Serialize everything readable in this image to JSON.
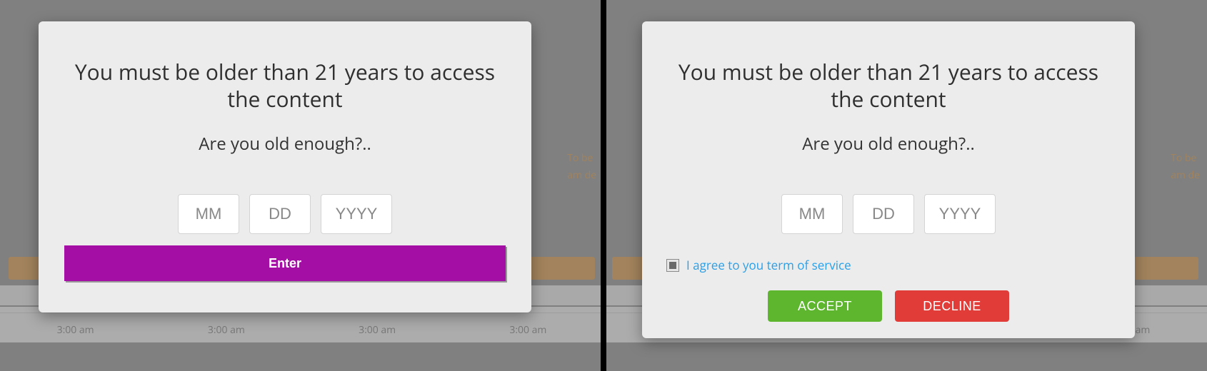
{
  "left": {
    "title": "You must be older than 21 years to access the content",
    "subtitle": "Are you old enough?..",
    "inputs": {
      "mm_placeholder": "MM",
      "dd_placeholder": "DD",
      "yyyy_placeholder": "YYYY",
      "mm_value": "",
      "dd_value": "",
      "yyyy_value": ""
    },
    "enter_label": "Enter"
  },
  "right": {
    "title": "You must be older than 21 years to access the content",
    "subtitle": "Are you old enough?..",
    "inputs": {
      "mm_placeholder": "MM",
      "dd_placeholder": "DD",
      "yyyy_placeholder": "YYYY",
      "mm_value": "",
      "dd_value": "",
      "yyyy_value": ""
    },
    "terms_label": "I agree to you term of service",
    "terms_checked": true,
    "accept_label": "ACCEPT",
    "decline_label": "DECLINE"
  },
  "background": {
    "time_cell": "3:00 am"
  }
}
